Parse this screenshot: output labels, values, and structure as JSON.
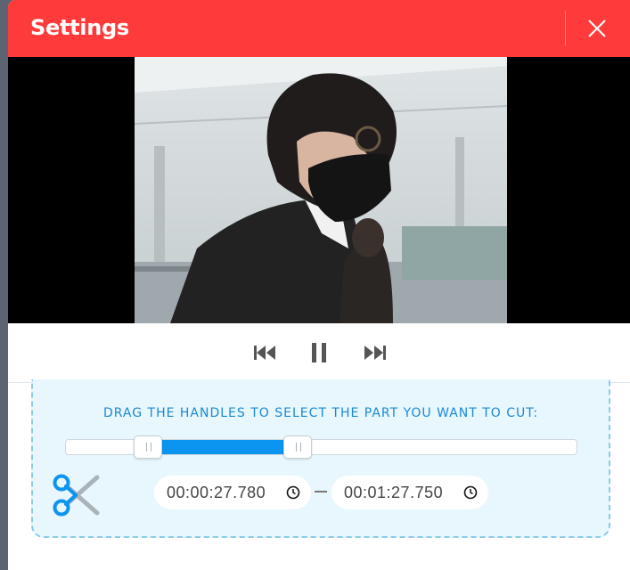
{
  "dialog": {
    "title": "Settings",
    "close_icon": "close-icon"
  },
  "player": {
    "controls": [
      {
        "name": "skip-back-icon"
      },
      {
        "name": "pause-icon"
      },
      {
        "name": "skip-forward-icon"
      }
    ]
  },
  "trimmer": {
    "instruction": "DRAG THE HANDLES TO SELECT THE PART YOU WANT TO CUT:",
    "selection_start_fraction": 0.16,
    "selection_end_fraction": 0.453,
    "start_time": "00:00:27.780",
    "end_time": "00:01:27.750",
    "separator": "–",
    "scissors_icon": "scissors-icon",
    "clock_icon": "clock-icon"
  },
  "colors": {
    "header": "#ff3a3a",
    "accent": "#0b94f0",
    "instruction_text": "#1a8ad3",
    "panel_bg": "#e8f6fd"
  }
}
